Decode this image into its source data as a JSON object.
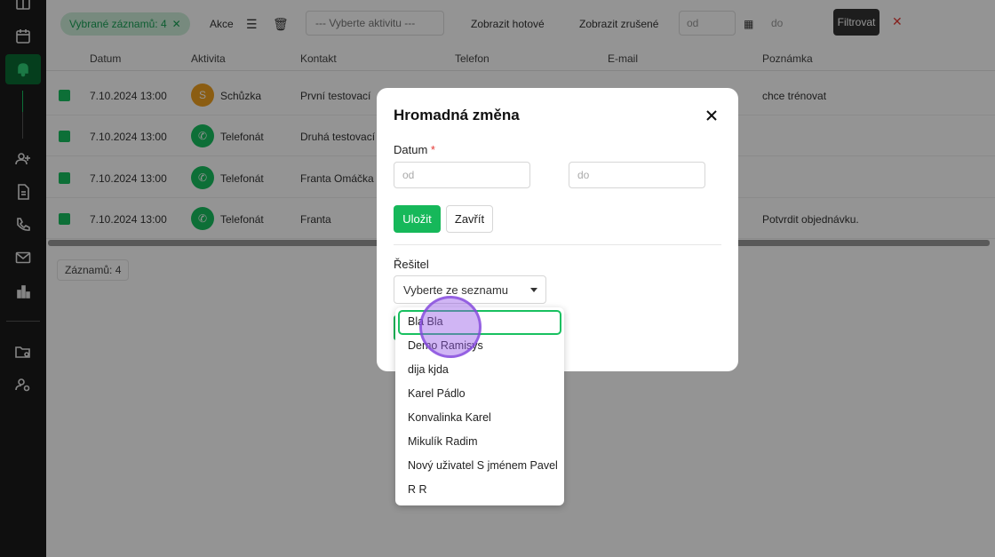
{
  "toolbar": {
    "chip_label": "Vybrané záznamů: 4",
    "chip_close": "✕",
    "actions_label": "Akce",
    "activity_select": "--- Vyberte aktivitu ---",
    "show_done": "Zobrazit hotové",
    "show_cancelled": "Zobrazit zrušené",
    "date_from": "od",
    "date_to": "do",
    "filter_button": "Filtrovat",
    "clear": "✕"
  },
  "table": {
    "headers": [
      "Datum",
      "Aktivita",
      "Kontakt",
      "Telefon",
      "E-mail",
      "Poznámka"
    ],
    "rows": [
      {
        "date": "7.10.2024 13:00",
        "activity": "Schůzka",
        "contact": "První testovací",
        "note": "chce trénovat",
        "icon": "S",
        "color": "orange"
      },
      {
        "date": "7.10.2024 13:00",
        "activity": "Telefonát",
        "contact": "Druhá testovací",
        "note": "",
        "icon": "phone-icon",
        "color": "green"
      },
      {
        "date": "7.10.2024 13:00",
        "activity": "Telefonát",
        "contact": "Franta Omáčka",
        "note": "",
        "icon": "phone-icon",
        "color": "green"
      },
      {
        "date": "7.10.2024 13:00",
        "activity": "Telefonát",
        "contact": "Franta",
        "note": "Potvrdit objednávku.",
        "icon": "phone-icon",
        "color": "green"
      }
    ],
    "records_label": "Záznamů: 4"
  },
  "modal": {
    "title": "Hromadná změna",
    "date_label": "Datum",
    "required_mark": "*",
    "date_from_placeholder": "od",
    "date_to_placeholder": "do",
    "save_button": "Uložit",
    "close_button": "Zavřít",
    "assignee_label": "Řešitel",
    "assignee_select": "Vyberte ze seznamu"
  },
  "dropdown": {
    "options": [
      "Bla Bla",
      "Demo Ramisys",
      "dija kjda",
      "Karel Pádlo",
      "Konvalinka Karel",
      "Mikulík Radim",
      "Nový uživatel S jménem Pavel",
      "R R"
    ],
    "highlighted_index": 0
  },
  "colors": {
    "accent": "#16b85a",
    "sidebar": "#1b1b1b",
    "danger": "#e53935"
  }
}
